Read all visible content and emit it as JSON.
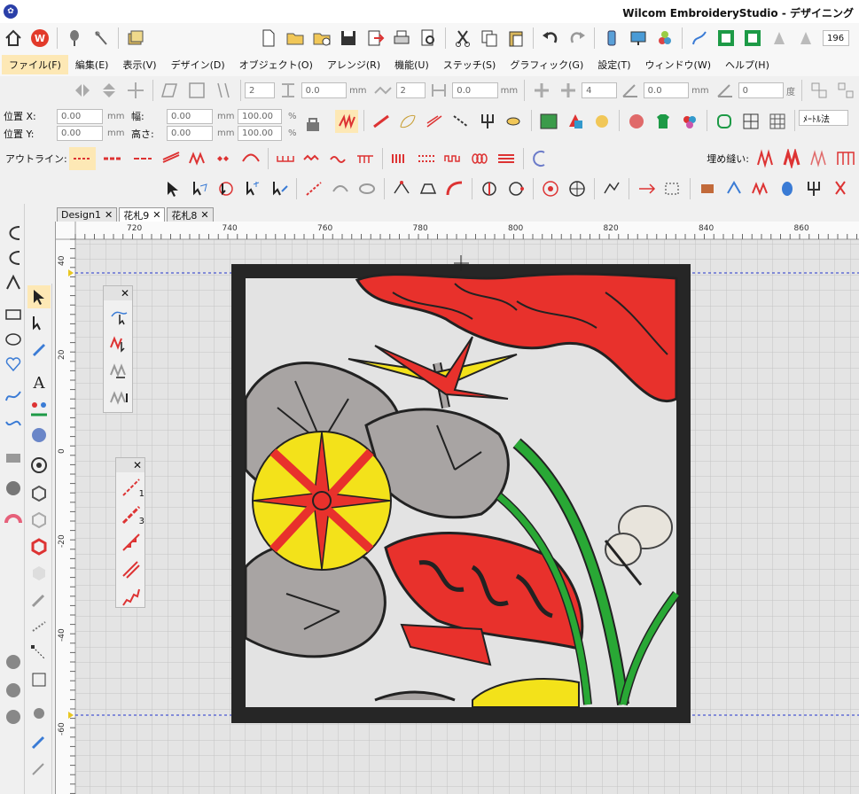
{
  "title": "Wilcom EmbroideryStudio - デザイニング",
  "menu": [
    "ファイル(F)",
    "編集(E)",
    "表示(V)",
    "デザイン(D)",
    "オブジェクト(O)",
    "アレンジ(R)",
    "機能(U)",
    "ステッチ(S)",
    "グラフィック(G)",
    "設定(T)",
    "ウィンドウ(W)",
    "ヘルプ(H)"
  ],
  "zoom_value": "196",
  "toolbar3": {
    "field1": "2",
    "field2": "0.0",
    "unit": "mm",
    "field3": "2",
    "field4": "0.0",
    "field5": "4",
    "field6": "0.0",
    "field7": "0",
    "deg": "度"
  },
  "props": {
    "pos_x_label": "位置 X:",
    "pos_y_label": "位置 Y:",
    "pos_x": "0.00",
    "pos_y": "0.00",
    "width_label": "幅:",
    "height_label": "高さ:",
    "width": "0.00",
    "height": "0.00",
    "scale_w": "100.00",
    "scale_h": "100.00",
    "unit": "mm",
    "pct": "%",
    "measure": "ﾒｰﾄﾙ法"
  },
  "outline_label": "アウトライン:",
  "fill_label": "埋め縫い:",
  "tabs": [
    {
      "label": "Design1",
      "active": false
    },
    {
      "label": "花札9",
      "active": true
    },
    {
      "label": "花札8",
      "active": false
    }
  ],
  "ruler_top": [
    "720",
    "740",
    "760",
    "780",
    "800",
    "820",
    "840",
    "860"
  ],
  "ruler_left": [
    "40",
    "20",
    "0",
    "-20",
    "-40",
    "-60"
  ],
  "dock2_labels": [
    "1",
    "3"
  ],
  "colors": {
    "red": "#e8312c",
    "yellow": "#f3e21a",
    "gray": "#a8a4a3",
    "green": "#29a835",
    "black": "#222222",
    "frame": "#262626"
  }
}
